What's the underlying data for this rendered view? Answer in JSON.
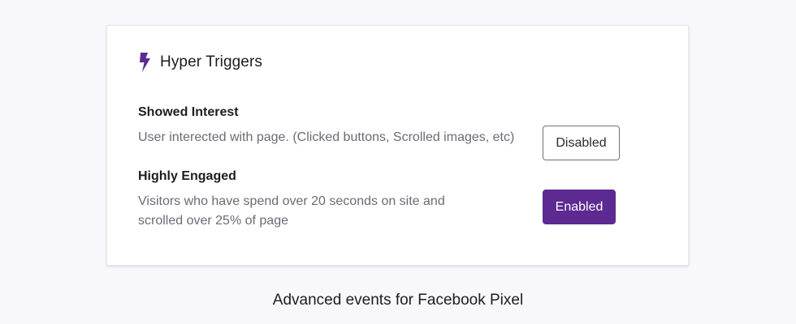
{
  "card": {
    "title": "Hyper Triggers",
    "icon": "lightning-bolt-icon",
    "accent_color": "#5c2a91"
  },
  "triggers": [
    {
      "name": "Showed Interest",
      "description": "User interected with page. (Clicked buttons, Scrolled images, etc)",
      "button_label": "Disabled",
      "state": "disabled"
    },
    {
      "name": "Highly Engaged",
      "description": "Visitors who have spend over 20 seconds on site and scrolled over 25% of page",
      "button_label": "Enabled",
      "state": "enabled"
    }
  ],
  "caption": "Advanced events for Facebook Pixel"
}
